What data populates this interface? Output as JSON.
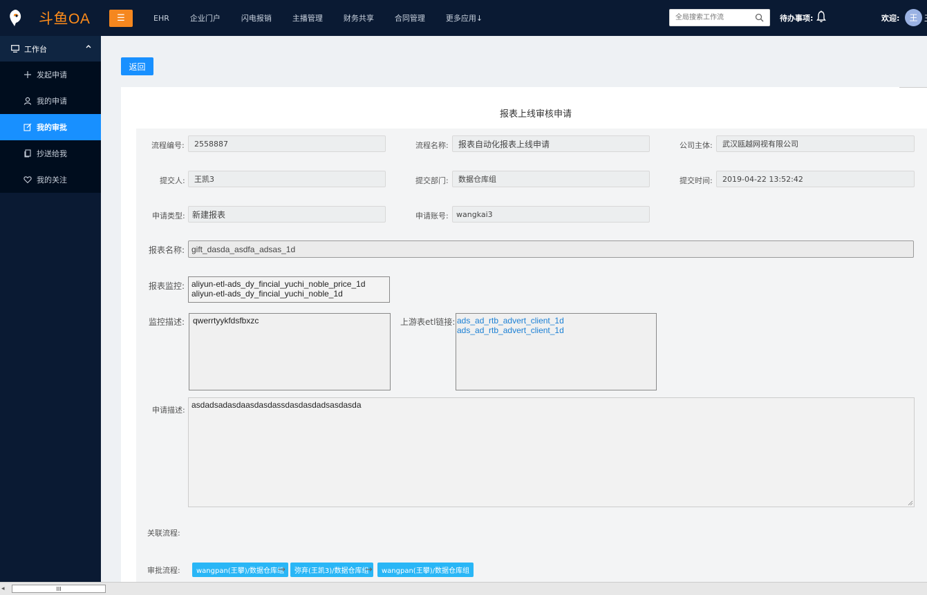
{
  "app": {
    "logo_text": "斗鱼OA",
    "menu_toggle_glyph": "☰"
  },
  "topnav": {
    "items": [
      {
        "label": "EHR"
      },
      {
        "label": "企业门户"
      },
      {
        "label": "闪电报销"
      },
      {
        "label": "主播管理"
      },
      {
        "label": "财务共享"
      },
      {
        "label": "合同管理"
      },
      {
        "label": "更多应用↓"
      }
    ],
    "search_placeholder": "全局搜索工作流",
    "todo_label": "待办事项:",
    "welcome_label": "欢迎:",
    "avatar_text": "王",
    "avatar_trailing": "王"
  },
  "sidebar": {
    "section_title": "工作台",
    "items": [
      {
        "label": "发起申请",
        "icon": "plus-icon"
      },
      {
        "label": "我的申请",
        "icon": "user-icon"
      },
      {
        "label": "我的审批",
        "icon": "edit-icon",
        "active": true
      },
      {
        "label": "抄送给我",
        "icon": "copy-icon"
      },
      {
        "label": "我的关注",
        "icon": "heart-icon"
      }
    ]
  },
  "page": {
    "back_label": "返回",
    "title": "报表上线审核申请"
  },
  "form": {
    "process_no": {
      "label": "流程编号:",
      "value": "2558887"
    },
    "process_name": {
      "label": "流程名称:",
      "value": "报表自动化报表上线申请"
    },
    "company": {
      "label": "公司主体:",
      "value": "武汉瓯越网视有限公司"
    },
    "submitter": {
      "label": "提交人:",
      "value": "王凯3"
    },
    "department": {
      "label": "提交部门:",
      "value": "数据仓库组"
    },
    "submit_time": {
      "label": "提交时间:",
      "value": "2019-04-22 13:52:42"
    },
    "apply_type": {
      "label": "申请类型:",
      "value": "新建报表"
    },
    "apply_account": {
      "label": "申请账号:",
      "value": "wangkai3"
    },
    "report_name": {
      "label": "报表名称:",
      "value": "gift_dasda_asdfa_adsas_1d"
    },
    "report_monitor": {
      "label": "报表监控:",
      "lines": [
        "aliyun-etl-ads_dy_fincial_yuchi_noble_price_1d",
        "aliyun-etl-ads_dy_fincial_yuchi_noble_1d"
      ]
    },
    "monitor_desc": {
      "label": "监控描述:",
      "value": "qwerrtyykfdsfbxzc"
    },
    "upstream_links": {
      "label": "上游表etl链接:",
      "lines": [
        "ads_ad_rtb_advert_client_1d",
        "ads_ad_rtb_advert_client_1d"
      ]
    },
    "apply_desc": {
      "label": "申请描述:",
      "value": "asdadsadasdaasdasdassdasdasdadsasdasda"
    },
    "related_flow": {
      "label": "关联流程:"
    },
    "approval_flow": {
      "label": "审批流程:",
      "steps": [
        "wangpan(王攀)/数据仓库组",
        "弥弃(王凯3)/数据仓库组",
        "wangpan(王攀)/数据仓库组"
      ]
    }
  },
  "scrollbar": {
    "thumb_glyph": "III",
    "left_arrow": "◂"
  }
}
